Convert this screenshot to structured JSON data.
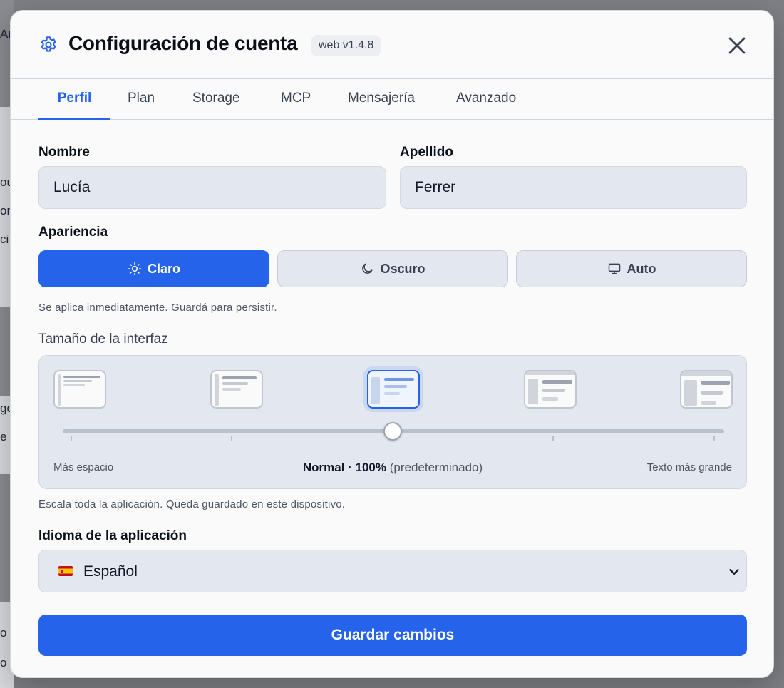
{
  "background": {
    "fragments": [
      "Ar",
      "ou",
      "on",
      "ci",
      "go",
      "e",
      "o",
      "o"
    ]
  },
  "dialog": {
    "title": "Configuración de cuenta",
    "version": "web v1.4.8",
    "icon": "gear-icon",
    "close_icon": "close-icon"
  },
  "tabs": [
    {
      "label": "Perfil",
      "active": true
    },
    {
      "label": "Plan",
      "active": false
    },
    {
      "label": "Storage",
      "active": false
    },
    {
      "label": "MCP",
      "active": false
    },
    {
      "label": "Mensajería",
      "active": false
    },
    {
      "label": "Avanzado",
      "active": false
    }
  ],
  "profile": {
    "first_name_label": "Nombre",
    "first_name_value": "Lucía",
    "last_name_label": "Apellido",
    "last_name_value": "Ferrer"
  },
  "appearance": {
    "label": "Apariencia",
    "options": [
      {
        "label": "Claro",
        "icon": "sun-icon",
        "selected": true
      },
      {
        "label": "Oscuro",
        "icon": "moon-icon",
        "selected": false
      },
      {
        "label": "Auto",
        "icon": "monitor-icon",
        "selected": false
      }
    ],
    "hint": "Se aplica inmediatamente. Guardá para persistir."
  },
  "interface_size": {
    "label": "Tamaño de la interfaz",
    "presets_count": 5,
    "selected_index": 2,
    "left_label": "Más espacio",
    "right_label": "Texto más grande",
    "current_name": "Normal · 100%",
    "current_suffix": "(predeterminado)",
    "hint": "Escala toda la aplicación. Queda guardado en este dispositivo."
  },
  "language": {
    "label": "Idioma de la aplicación",
    "selected": "Español",
    "flag_icon": "spain-flag-icon"
  },
  "actions": {
    "save_label": "Guardar cambios"
  },
  "colors": {
    "accent": "#2563eb",
    "field_bg": "#e3e7ef",
    "modal_bg": "#fafafa"
  }
}
